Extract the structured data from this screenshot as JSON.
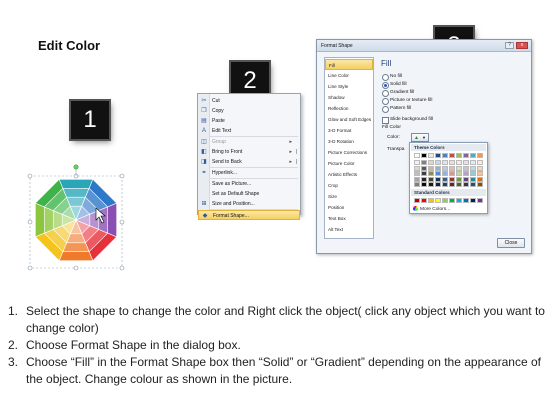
{
  "title": "Edit Color",
  "badges": [
    "1",
    "2",
    "3"
  ],
  "context_menu": {
    "items": [
      {
        "label": "Cut",
        "icon": "scissors-icon",
        "glyph": "✂",
        "disabled": false
      },
      {
        "label": "Copy",
        "icon": "copy-icon",
        "glyph": "❐",
        "disabled": false
      },
      {
        "label": "Paste",
        "icon": "paste-icon",
        "glyph": "▤",
        "disabled": false
      },
      {
        "label": "Edit Text",
        "icon": "edit-text-icon",
        "glyph": "A",
        "disabled": false
      },
      {
        "label": "Group",
        "icon": "group-icon",
        "glyph": "◫",
        "disabled": true,
        "submenu": true
      },
      {
        "label": "Bring to Front",
        "icon": "bring-to-front-icon",
        "glyph": "◧",
        "disabled": false,
        "submenu": true
      },
      {
        "label": "Send to Back",
        "icon": "send-to-back-icon",
        "glyph": "◨",
        "disabled": false,
        "submenu": true
      },
      {
        "label": "Hyperlink...",
        "icon": "hyperlink-icon",
        "glyph": "⚭",
        "disabled": false
      },
      {
        "label": "Save as Picture...",
        "icon": "save-picture-icon",
        "glyph": "",
        "disabled": false
      },
      {
        "label": "Set as Default Shape",
        "icon": "",
        "glyph": "",
        "disabled": false
      },
      {
        "label": "Size and Position...",
        "icon": "size-position-icon",
        "glyph": "⊞",
        "disabled": false
      },
      {
        "label": "Format Shape...",
        "icon": "format-shape-icon",
        "glyph": "◆",
        "disabled": false,
        "highlighted": true
      }
    ]
  },
  "dialog": {
    "title": "Format Shape",
    "categories": [
      "Fill",
      "Line Color",
      "Line Style",
      "Shadow",
      "Reflection",
      "Glow and Soft Edges",
      "3-D Format",
      "3-D Rotation",
      "Picture Corrections",
      "Picture Color",
      "Artistic Effects",
      "Crop",
      "Size",
      "Position",
      "Text Box",
      "Alt Text"
    ],
    "selected_category": "Fill",
    "fill_heading": "Fill",
    "fill_options": [
      {
        "label": "No fill",
        "selected": false
      },
      {
        "label": "Solid fill",
        "selected": true
      },
      {
        "label": "Gradient fill",
        "selected": false
      },
      {
        "label": "Picture or texture fill",
        "selected": false
      },
      {
        "label": "Pattern fill",
        "selected": false
      }
    ],
    "slide_bg_label": "Slide background fill",
    "fill_color_label": "Fill Color",
    "color_label": "Color:",
    "transparency_label": "Transpa",
    "close_label": "Close",
    "window_controls": [
      "?",
      "x"
    ]
  },
  "palette": {
    "theme_label": "Theme Colors",
    "standard_label": "Standard Colors",
    "more_label": "More Colors...",
    "theme_top": [
      "#ffffff",
      "#000000",
      "#eeece1",
      "#1f497d",
      "#4f81bd",
      "#c0504d",
      "#9bbb59",
      "#8064a2",
      "#4bacc6",
      "#f79646"
    ],
    "theme_shades": [
      [
        "#f2f2f2",
        "#7f7f7f",
        "#ddd9c3",
        "#c6d9f0",
        "#dbe5f1",
        "#f2dcdb",
        "#ebf1dd",
        "#e5e0ec",
        "#dbeef3",
        "#fdeada"
      ],
      [
        "#d8d8d8",
        "#595959",
        "#c4bd97",
        "#8db3e2",
        "#b8cce4",
        "#e5b9b7",
        "#d7e3bc",
        "#ccc1d9",
        "#b7dde8",
        "#fbd5b5"
      ],
      [
        "#bfbfbf",
        "#3f3f3f",
        "#938953",
        "#548dd4",
        "#95b3d7",
        "#d99694",
        "#c3d69b",
        "#b2a2c7",
        "#92cddc",
        "#fac08f"
      ],
      [
        "#a5a5a5",
        "#262626",
        "#494429",
        "#17365d",
        "#366092",
        "#953734",
        "#76923c",
        "#5f497a",
        "#31859b",
        "#e36c09"
      ],
      [
        "#7f7f7f",
        "#0c0c0c",
        "#1d1b10",
        "#0f243e",
        "#244061",
        "#632423",
        "#4f6128",
        "#3f3151",
        "#205867",
        "#974806"
      ]
    ],
    "standard": [
      "#c00000",
      "#ff0000",
      "#ffc000",
      "#ffff00",
      "#92d050",
      "#00b050",
      "#00b0f0",
      "#0070c0",
      "#002060",
      "#7030a0"
    ]
  },
  "instructions": [
    {
      "num": "1.",
      "text": "Select the shape to change the color and Right click the object( click any object which you want to change color)"
    },
    {
      "num": "2.",
      "text": "Choose Format Shape in the dialog box."
    },
    {
      "num": "3.",
      "text": "Choose “Fill” in the Format Shape box then “Solid” or “Gradient” depending on the appearance of the object. Change colour as shown in the picture."
    }
  ],
  "octagon_colors": [
    "#e8303a",
    "#f07a2a",
    "#f4c320",
    "#8cc63f",
    "#3db34a",
    "#2aa6b8",
    "#2d78c8",
    "#8a4fb3"
  ]
}
